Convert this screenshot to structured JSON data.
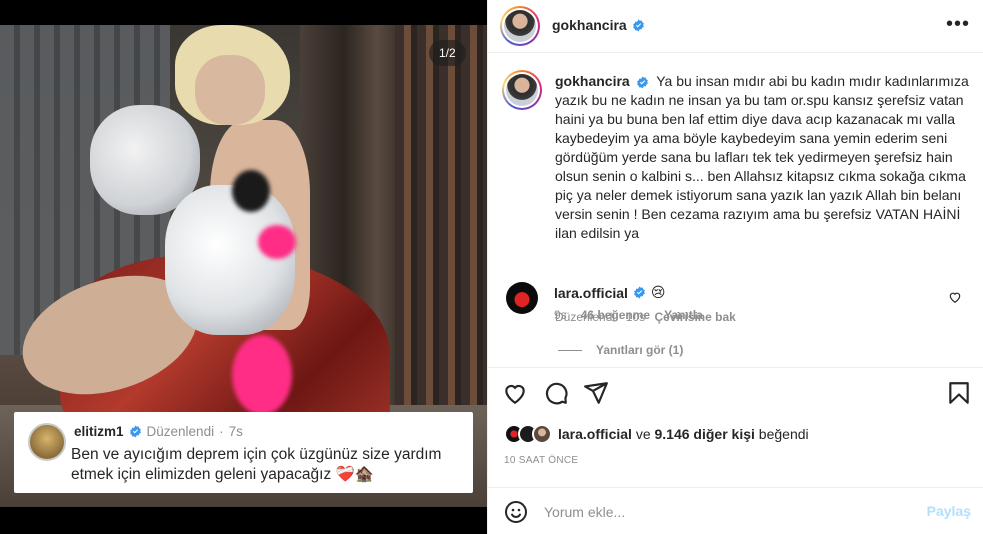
{
  "post": {
    "media_counter": "1/2",
    "story_card": {
      "username": "elitizm1",
      "edited": "Düzenlendi",
      "separator": "·",
      "age": "7s",
      "text": "Ben ve ayıcığım deprem için çok üzgünüz size yardım etmek için elimizden geleni yapacağız ❤️‍🩹🏚️"
    }
  },
  "header": {
    "username": "gokhancira",
    "more_icon": "more-horizontal-icon"
  },
  "caption": {
    "username": "gokhancira",
    "text": "Ya bu insan mıdır abi bu kadın mıdır kadınlarımıza yazık bu ne kadın ne insan ya bu tam or.spu kansız şerefsiz vatan haini ya bu buna ben laf ettim diye dava acıp kazanacak mı valla kaybedeyim ya ama böyle kaybedeyim sana yemin ederim seni gördüğüm yerde sana bu lafları tek tek yedirmeyen şerefsiz hain olsun senin o kalbini s... ben Allahsız kitapsız cıkma sokağa cıkma piç ya neler demek istiyorum sana yazık lan yazık Allah bin belanı versin senin ! Ben cezama razıyım ama bu şerefsiz VATAN HAİNİ ilan edilsin ya",
    "edited": "Düzenlendi",
    "separator": "·",
    "age": "10s",
    "translate": "Çevirisine bak"
  },
  "comment": {
    "username": "lara.official",
    "emoji": "😢",
    "age": "9s",
    "likes": "46 beğenme",
    "reply": "Yanıtla"
  },
  "replies": {
    "label": "Yanıtları gör (1)"
  },
  "actions": {
    "like_icon": "heart-icon",
    "comment_icon": "comment-icon",
    "share_icon": "send-icon",
    "save_icon": "bookmark-icon"
  },
  "likes": {
    "first_user": "lara.official",
    "connector": "ve",
    "others": "9.146 diğer kişi",
    "suffix": "beğendi"
  },
  "time_ago": "10 SAAT ÖNCE",
  "comment_box": {
    "placeholder": "Yorum ekle...",
    "post_label": "Paylaş"
  },
  "colors": {
    "verified": "#3897f0",
    "text_primary": "#262626",
    "text_secondary": "#8e8e8e",
    "post_button_disabled": "#b2dffc"
  }
}
